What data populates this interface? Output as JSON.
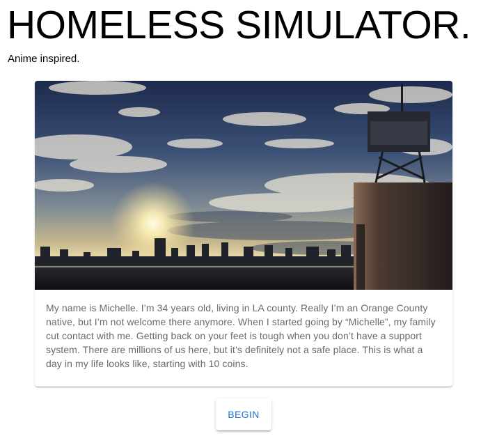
{
  "header": {
    "title": "HOMELESS SIMULATOR.",
    "subtitle": "Anime inspired."
  },
  "card": {
    "image_description": "anime-city-skyline-sunset-image",
    "text": "My name is Michelle. I’m 34 years old, living in LA county. Really I’m an Orange County native, but I’m not welcome there anymore. When I started going by “Michelle”, my family cut contact with me. Getting back on your feet is tough when you don’t have a support system. There are millions of us here, but it’s definitely not a safe place. This is what a day in my life looks like, starting with 10 coins."
  },
  "actions": {
    "begin_label": "BEGIN"
  },
  "colors": {
    "accent": "#1976d2",
    "body_text": "#666666"
  }
}
